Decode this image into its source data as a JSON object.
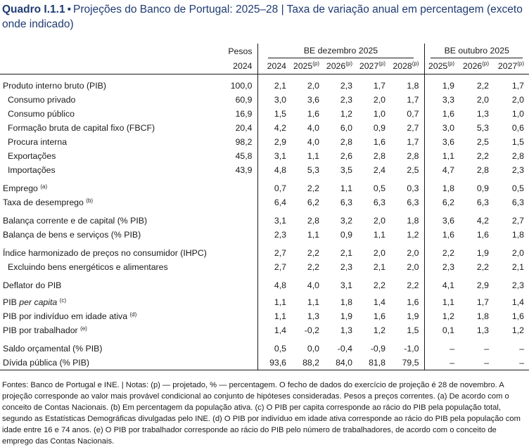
{
  "title": {
    "label": "Quadro I.1.1",
    "bullet": "•",
    "text": "Projeções do Banco de Portugal: 2025–28 | Taxa de variação anual em percentagem (exceto onde indicado)"
  },
  "headers": {
    "weights_line1": "Pesos",
    "weights_line2": "2024",
    "group_dec": "BE dezembro 2025",
    "group_oct": "BE outubro 2025",
    "dec_years": [
      {
        "year": "2024",
        "sup": ""
      },
      {
        "year": "2025",
        "sup": "(p)"
      },
      {
        "year": "2026",
        "sup": "(p)"
      },
      {
        "year": "2027",
        "sup": "(p)"
      },
      {
        "year": "2028",
        "sup": "(p)"
      }
    ],
    "oct_years": [
      {
        "year": "2025",
        "sup": "(p)"
      },
      {
        "year": "2026",
        "sup": "(p)"
      },
      {
        "year": "2027",
        "sup": "(p)"
      }
    ]
  },
  "rows": [
    {
      "label": "Produto interno bruto (PIB)",
      "weight": "100,0",
      "dec": [
        "2,1",
        "2,0",
        "2,3",
        "1,7",
        "1,8"
      ],
      "oct": [
        "1,9",
        "2,2",
        "1,7"
      ]
    },
    {
      "label": "Consumo privado",
      "indent": true,
      "weight": "60,9",
      "dec": [
        "3,0",
        "3,6",
        "2,3",
        "2,0",
        "1,7"
      ],
      "oct": [
        "3,3",
        "2,0",
        "2,0"
      ]
    },
    {
      "label": "Consumo público",
      "indent": true,
      "weight": "16,9",
      "dec": [
        "1,5",
        "1,6",
        "1,2",
        "1,0",
        "0,7"
      ],
      "oct": [
        "1,6",
        "1,3",
        "1,0"
      ]
    },
    {
      "label": "Formação bruta de capital fixo (FBCF)",
      "indent": true,
      "weight": "20,4",
      "dec": [
        "4,2",
        "4,0",
        "6,0",
        "0,9",
        "2,7"
      ],
      "oct": [
        "3,0",
        "5,3",
        "0,6"
      ]
    },
    {
      "label": "Procura interna",
      "indent": true,
      "weight": "98,2",
      "dec": [
        "2,9",
        "4,0",
        "2,8",
        "1,6",
        "1,7"
      ],
      "oct": [
        "3,6",
        "2,5",
        "1,5"
      ]
    },
    {
      "label": "Exportações",
      "indent": true,
      "weight": "45,8",
      "dec": [
        "3,1",
        "1,1",
        "2,6",
        "2,8",
        "2,8"
      ],
      "oct": [
        "1,1",
        "2,2",
        "2,8"
      ]
    },
    {
      "label": "Importações",
      "indent": true,
      "weight": "43,9",
      "dec": [
        "4,8",
        "5,3",
        "3,5",
        "2,4",
        "2,5"
      ],
      "oct": [
        "4,7",
        "2,8",
        "2,3"
      ]
    },
    {
      "label": "Emprego",
      "sup": "(a)",
      "weight": "",
      "dec": [
        "0,7",
        "2,2",
        "1,1",
        "0,5",
        "0,3"
      ],
      "oct": [
        "1,8",
        "0,9",
        "0,5"
      ]
    },
    {
      "label": "Taxa de desemprego",
      "sup": "(b)",
      "weight": "",
      "dec": [
        "6,4",
        "6,2",
        "6,3",
        "6,3",
        "6,3"
      ],
      "oct": [
        "6,2",
        "6,3",
        "6,3"
      ]
    },
    {
      "label": "Balança corrente e de capital (% PIB)",
      "weight": "",
      "dec": [
        "3,1",
        "2,8",
        "3,2",
        "2,0",
        "1,8"
      ],
      "oct": [
        "3,6",
        "4,2",
        "2,7"
      ]
    },
    {
      "label": "Balança de bens e serviços (% PIB)",
      "weight": "",
      "dec": [
        "2,3",
        "1,1",
        "0,9",
        "1,1",
        "1,2"
      ],
      "oct": [
        "1,6",
        "1,6",
        "1,8"
      ]
    },
    {
      "label": "Índice harmonizado de preços no consumidor (IHPC)",
      "weight": "",
      "dec": [
        "2,7",
        "2,2",
        "2,1",
        "2,0",
        "2,0"
      ],
      "oct": [
        "2,2",
        "1,9",
        "2,0"
      ]
    },
    {
      "label": "Excluindo bens energéticos e alimentares",
      "indent": true,
      "weight": "",
      "dec": [
        "2,7",
        "2,2",
        "2,3",
        "2,1",
        "2,0"
      ],
      "oct": [
        "2,3",
        "2,2",
        "2,1"
      ]
    },
    {
      "label": "Deflator do PIB",
      "weight": "",
      "dec": [
        "4,8",
        "4,0",
        "3,1",
        "2,2",
        "2,2"
      ],
      "oct": [
        "4,1",
        "2,9",
        "2,3"
      ]
    },
    {
      "label": "PIB",
      "label_italic": "per capita",
      "sup": "(c)",
      "weight": "",
      "dec": [
        "1,1",
        "1,1",
        "1,8",
        "1,4",
        "1,6"
      ],
      "oct": [
        "1,1",
        "1,7",
        "1,4"
      ]
    },
    {
      "label": "PIB por indivíduo em idade ativa",
      "sup": "(d)",
      "weight": "",
      "dec": [
        "1,1",
        "1,3",
        "1,9",
        "1,6",
        "1,9"
      ],
      "oct": [
        "1,2",
        "1,8",
        "1,6"
      ]
    },
    {
      "label": "PIB por trabalhador",
      "sup": "(e)",
      "weight": "",
      "dec": [
        "1,4",
        "-0,2",
        "1,3",
        "1,2",
        "1,5"
      ],
      "oct": [
        "0,1",
        "1,3",
        "1,2"
      ]
    },
    {
      "label": "Saldo orçamental (% PIB)",
      "weight": "",
      "dec": [
        "0,5",
        "0,0",
        "-0,4",
        "-0,9",
        "-1,0"
      ],
      "oct": [
        "–",
        "–",
        "–"
      ]
    },
    {
      "label": "Dívida pública (% PIB)",
      "weight": "",
      "dec": [
        "93,6",
        "88,2",
        "84,0",
        "81,8",
        "79,5"
      ],
      "oct": [
        "–",
        "–",
        "–"
      ]
    }
  ],
  "notes": "Fontes: Banco de Portugal e INE. | Notas: (p) — projetado, % — percentagem. O fecho de dados do exercício de projeção é 28 de novembro. A projeção corresponde ao valor mais provável condicional ao conjunto de hipóteses consideradas. Pesos a preços correntes. (a) De acordo com o conceito de Contas Nacionais. (b) Em percentagem da população ativa. (c) O PIB per capita corresponde ao rácio do PIB pela população total, segundo as Estatísticas Demográficas divulgadas pelo INE. (d) O PIB por indivíduo em idade ativa corresponde ao rácio do PIB pela população com idade entre 16 e 74 anos. (e) O PIB por trabalhador corresponde ao rácio do PIB pelo número de trabalhadores, de acordo com o conceito de emprego das Contas Nacionais."
}
